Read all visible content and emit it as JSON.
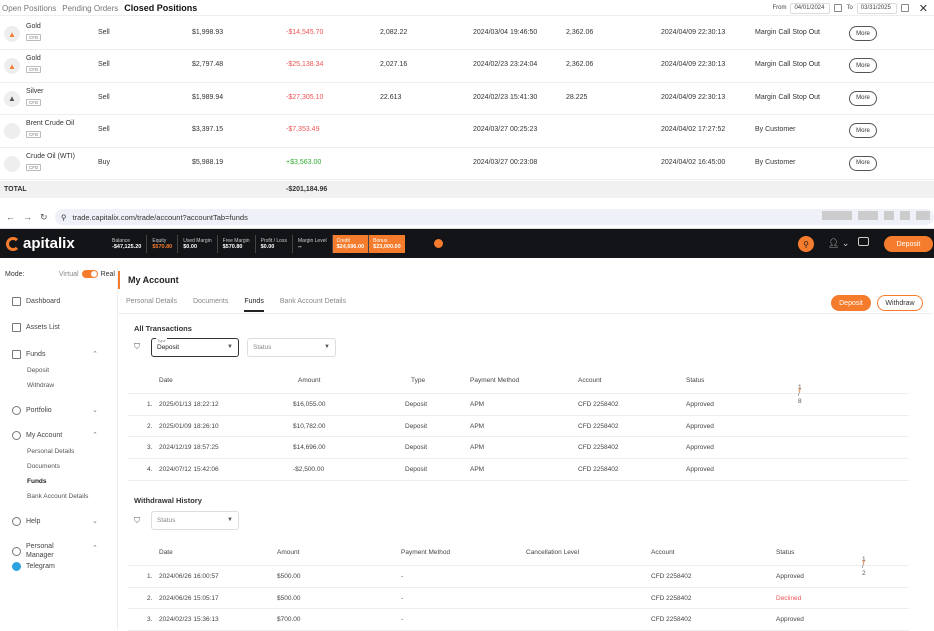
{
  "top_tabs": {
    "open": "Open Positions",
    "pending": "Pending Orders",
    "closed": "Closed Positions"
  },
  "date_range": {
    "from_label": "From",
    "from": "04/01/2024",
    "to_label": "To",
    "to": "03/31/2025"
  },
  "positions": [
    {
      "name": "Gold",
      "tag": "CFD",
      "side": "Sell",
      "amount": "$1,998.93",
      "pl": "-$14,545.70",
      "open_price": "2,082.22",
      "open_time": "2024/03/04 19:46:50",
      "close_price": "2,362.06",
      "close_time": "2024/04/09 22:30:13",
      "reason": "Margin Call Stop Out",
      "more": "More",
      "pl_sign": "neg"
    },
    {
      "name": "Gold",
      "tag": "CFD",
      "side": "Sell",
      "amount": "$2,797.48",
      "pl": "-$25,138.34",
      "open_price": "2,027.16",
      "open_time": "2024/02/23 23:24:04",
      "close_price": "2,362.06",
      "close_time": "2024/04/09 22:30:13",
      "reason": "Margin Call Stop Out",
      "more": "More",
      "pl_sign": "neg"
    },
    {
      "name": "Silver",
      "tag": "CFD",
      "side": "Sell",
      "amount": "$1,989.94",
      "pl": "-$27,305.10",
      "open_price": "22.613",
      "open_time": "2024/02/23 15:41:30",
      "close_price": "28.225",
      "close_time": "2024/04/09 22:30:13",
      "reason": "Margin Call Stop Out",
      "more": "More",
      "pl_sign": "neg"
    },
    {
      "name": "Brent Crude Oil",
      "tag": "CFD",
      "side": "Sell",
      "amount": "$3,397.15",
      "pl": "-$7,353.49",
      "open_price": "",
      "open_time": "2024/03/27 00:25:23",
      "close_price": "",
      "close_time": "2024/04/02 17:27:52",
      "reason": "By Customer",
      "more": "More",
      "pl_sign": "neg"
    },
    {
      "name": "Crude Oil (WTI)",
      "tag": "CFD",
      "side": "Buy",
      "amount": "$5,988.19",
      "pl": "+$3,563.00",
      "open_price": "",
      "open_time": "2024/03/27 00:23:08",
      "close_price": "",
      "close_time": "2024/04/02 16:45:00",
      "reason": "By Customer",
      "more": "More",
      "pl_sign": "pos"
    }
  ],
  "total": {
    "label": "TOTAL",
    "value": "-$201,184.96"
  },
  "browser": {
    "url": "trade.capitalix.com/trade/account?accountTab=funds"
  },
  "app": {
    "logo": "apitalix",
    "stats": [
      {
        "label": "Balance",
        "value": "-$47,125.20"
      },
      {
        "label": "Equity",
        "value": "$570.80"
      },
      {
        "label": "Used Margin",
        "value": "$0.00"
      },
      {
        "label": "Free Margin",
        "value": "$570.80"
      },
      {
        "label": "Profit / Loss",
        "value": "$0.00"
      },
      {
        "label": "Margin Level",
        "value": "--"
      },
      {
        "label": "Credit",
        "value": "$24,696.00"
      },
      {
        "label": "Bonus",
        "value": "$23,000.00"
      }
    ],
    "deposit": "Deposit"
  },
  "sidebar": {
    "mode_label": "Mode:",
    "virtual": "Virtual",
    "real": "Real",
    "dashboard": "Dashboard",
    "assets": "Assets List",
    "funds": "Funds",
    "funds_sub": [
      "Deposit",
      "Withdraw"
    ],
    "portfolio": "Portfolio",
    "account": "My Account",
    "account_sub": [
      "Personal Details",
      "Documents",
      "Funds",
      "Bank Account Details"
    ],
    "help": "Help",
    "manager": "Personal Manager",
    "telegram": "Telegram"
  },
  "main": {
    "title": "My Account",
    "tabs": [
      "Personal Details",
      "Documents",
      "Funds",
      "Bank Account Details"
    ],
    "deposit": "Deposit",
    "withdraw": "Withdraw",
    "all_tx": "All Transactions",
    "type_label": "Type",
    "type_value": "Deposit",
    "status_placeholder": "Status",
    "tx_headers": [
      "Date",
      "Amount",
      "Type",
      "Payment Method",
      "Account",
      "Status"
    ],
    "tx_pager": "1 / 8",
    "transactions": [
      {
        "n": "1.",
        "date": "2025/01/13 18:22:12",
        "amount": "$16,055.00",
        "type": "Deposit",
        "method": "APM",
        "account": "CFD 2258402",
        "status": "Approved"
      },
      {
        "n": "2.",
        "date": "2025/01/09 18:26:10",
        "amount": "$10,782.00",
        "type": "Deposit",
        "method": "APM",
        "account": "CFD 2258402",
        "status": "Approved"
      },
      {
        "n": "3.",
        "date": "2024/12/19 18:57:25",
        "amount": "$14,696.00",
        "type": "Deposit",
        "method": "APM",
        "account": "CFD 2258402",
        "status": "Approved"
      },
      {
        "n": "4.",
        "date": "2024/07/12 15:42:06",
        "amount": "-$2,500.00",
        "type": "Deposit",
        "method": "APM",
        "account": "CFD 2258402",
        "status": "Approved"
      }
    ],
    "wd_title": "Withdrawal History",
    "wd_headers": [
      "Date",
      "Amount",
      "Payment Method",
      "Cancellation Level",
      "Account",
      "Status"
    ],
    "wd_pager": "1 / 2",
    "withdrawals": [
      {
        "n": "1.",
        "date": "2024/06/26 16:00:57",
        "amount": "$500.00",
        "method": "-",
        "account": "CFD 2258402",
        "status": "Approved"
      },
      {
        "n": "2.",
        "date": "2024/06/26 15:05:17",
        "amount": "$500.00",
        "method": "-",
        "account": "CFD 2258402",
        "status": "Declined"
      },
      {
        "n": "3.",
        "date": "2024/02/23 15:36:13",
        "amount": "$700.00",
        "method": "-",
        "account": "CFD 2258402",
        "status": "Approved"
      }
    ]
  }
}
